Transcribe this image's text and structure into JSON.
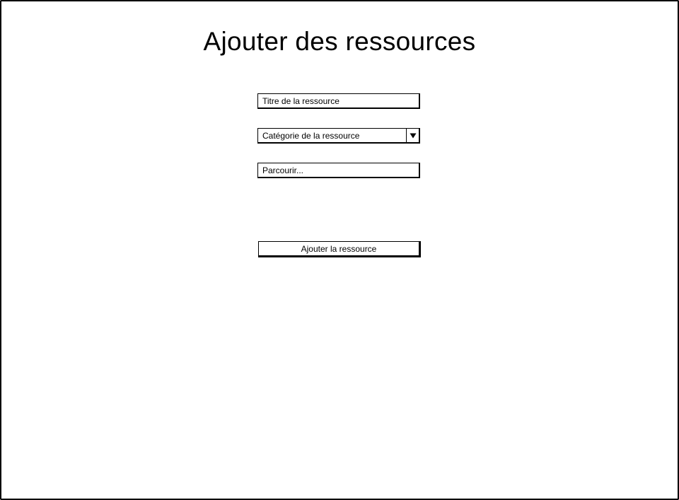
{
  "page": {
    "title": "Ajouter des ressources"
  },
  "form": {
    "title_field": {
      "placeholder": "Titre de la ressource"
    },
    "category_select": {
      "selected": "Catégorie de la ressource",
      "arrow_icon": "triangle-down-icon"
    },
    "browse_field": {
      "placeholder": "Parcourir..."
    },
    "submit_label": "Ajouter la ressource"
  }
}
